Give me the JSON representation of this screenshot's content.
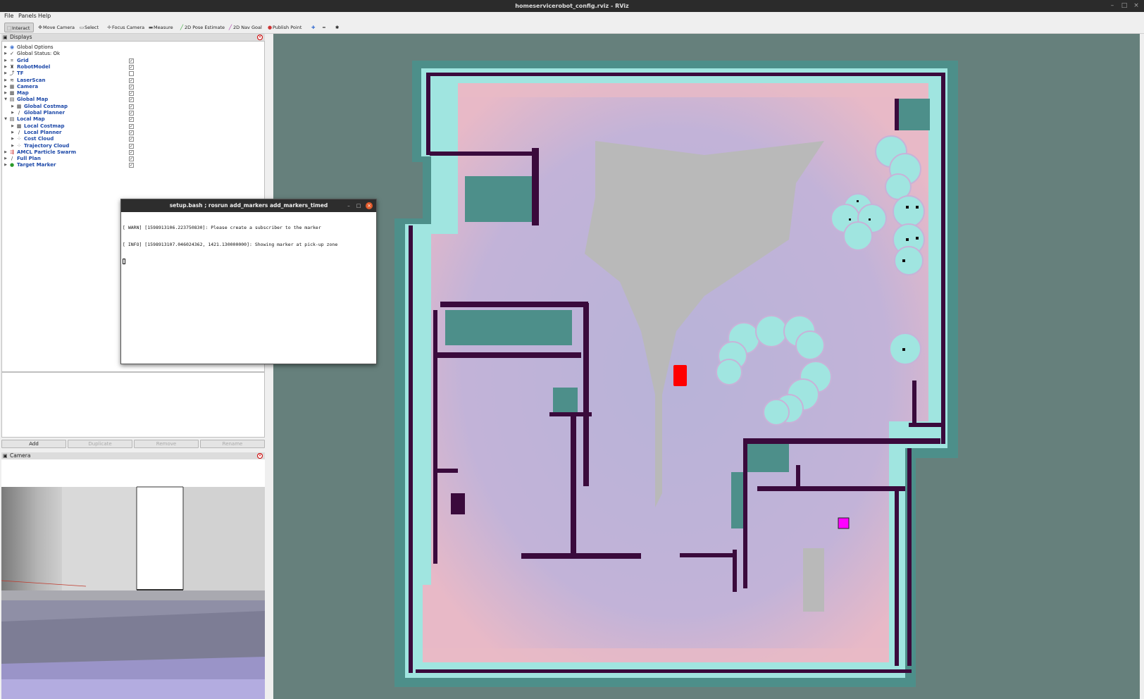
{
  "window": {
    "title": "homeservicerobot_config.rviz - RViz"
  },
  "menu": [
    "File",
    "Panels",
    "Help"
  ],
  "toolbar": {
    "tools": [
      {
        "label": "Interact",
        "icon": "interact-icon"
      },
      {
        "label": "Move Camera",
        "icon": "move-camera-icon"
      },
      {
        "label": "Select",
        "icon": "select-icon"
      },
      {
        "label": "Focus Camera",
        "icon": "focus-camera-icon"
      },
      {
        "label": "Measure",
        "icon": "measure-icon"
      },
      {
        "label": "2D Pose Estimate",
        "icon": "pose-estimate-icon"
      },
      {
        "label": "2D Nav Goal",
        "icon": "nav-goal-icon"
      },
      {
        "label": "Publish Point",
        "icon": "publish-point-icon"
      }
    ],
    "active_tool": "Interact"
  },
  "displays_panel": {
    "title": "Displays",
    "items": [
      {
        "label": "Global Options",
        "blue": false,
        "check": null,
        "level": 0,
        "icon": "globe-icon"
      },
      {
        "label": "Global Status: Ok",
        "blue": false,
        "check": null,
        "level": 0,
        "icon": "status-ok-icon"
      },
      {
        "label": "Grid",
        "blue": true,
        "check": true,
        "level": 0,
        "icon": "grid-icon"
      },
      {
        "label": "RobotModel",
        "blue": true,
        "check": true,
        "level": 0,
        "icon": "robot-model-icon"
      },
      {
        "label": "TF",
        "blue": true,
        "check": false,
        "level": 0,
        "icon": "tf-icon"
      },
      {
        "label": "LaserScan",
        "blue": true,
        "check": true,
        "level": 0,
        "icon": "laser-scan-icon"
      },
      {
        "label": "Camera",
        "blue": true,
        "check": true,
        "level": 0,
        "icon": "camera-icon"
      },
      {
        "label": "Map",
        "blue": true,
        "check": true,
        "level": 0,
        "icon": "map-icon"
      },
      {
        "label": "Global Map",
        "blue": true,
        "check": true,
        "level": 0,
        "icon": "folder-icon"
      },
      {
        "label": "Global Costmap",
        "blue": true,
        "check": true,
        "level": 1,
        "icon": "map-icon"
      },
      {
        "label": "Global Planner",
        "blue": true,
        "check": true,
        "level": 1,
        "icon": "path-icon"
      },
      {
        "label": "Local Map",
        "blue": true,
        "check": true,
        "level": 0,
        "icon": "folder-icon"
      },
      {
        "label": "Local Costmap",
        "blue": true,
        "check": true,
        "level": 1,
        "icon": "map-icon"
      },
      {
        "label": "Local Planner",
        "blue": true,
        "check": true,
        "level": 1,
        "icon": "path-icon"
      },
      {
        "label": "Cost Cloud",
        "blue": true,
        "check": true,
        "level": 1,
        "icon": "point-cloud-icon"
      },
      {
        "label": "Trajectory Cloud",
        "blue": true,
        "check": true,
        "level": 1,
        "icon": "point-cloud-icon"
      },
      {
        "label": "AMCL Particle Swarm",
        "blue": true,
        "check": true,
        "level": 0,
        "icon": "pose-array-icon"
      },
      {
        "label": "Full Plan",
        "blue": true,
        "check": true,
        "level": 0,
        "icon": "path-icon"
      },
      {
        "label": "Target Marker",
        "blue": true,
        "check": true,
        "level": 0,
        "icon": "marker-icon"
      }
    ],
    "buttons": [
      {
        "label": "Add",
        "enabled": true
      },
      {
        "label": "Duplicate",
        "enabled": false
      },
      {
        "label": "Remove",
        "enabled": false
      },
      {
        "label": "Rename",
        "enabled": false
      }
    ]
  },
  "camera_panel": {
    "title": "Camera"
  },
  "terminal": {
    "title": "setup.bash ; rosrun add_markers add_markers_timed",
    "lines": [
      "[ WARN] [1598913106.223750830]: Please create a subscriber to the marker",
      "[ INFO] [1598913107.046024362, 1421.130000000]: Showing marker at pick-up zone"
    ]
  },
  "colors": {
    "viewport_bg": "#66807c",
    "inflation": "#a0e5e0",
    "free_space": "#b6aedc",
    "wall": "#3a0a3c",
    "robot": "#ff0000",
    "target_marker": "#ff00ff"
  }
}
